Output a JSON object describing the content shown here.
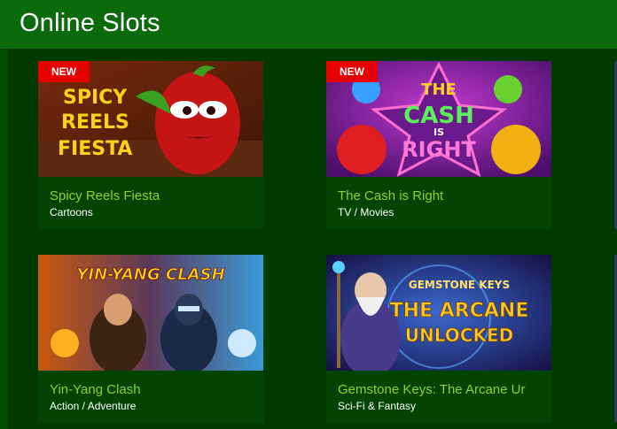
{
  "page": {
    "title": "Online Slots"
  },
  "games": [
    {
      "name": "Spicy Reels Fiesta",
      "category": "Cartoons",
      "badge": "NEW",
      "art_text": "SPICY REELS FIESTA"
    },
    {
      "name": "The Cash is Right",
      "category": "TV / Movies",
      "badge": "NEW",
      "art_text": "THE CASH IS RIGHT"
    },
    {
      "name": "Yin-Yang Clash",
      "category": "Action / Adventure",
      "badge": "",
      "art_text": "YIN-YANG CLASH"
    },
    {
      "name": "Gemstone Keys: The Arcane Ur",
      "category": "Sci-Fi & Fantasy",
      "badge": "",
      "art_text": "GEMSTONE KEYS THE ARCANE UNLOCKED"
    }
  ],
  "colors": {
    "header_bg": "#0b6a0b",
    "content_bg": "#013a01",
    "tile_bg": "#024402",
    "game_name": "#8fd22d",
    "badge_bg": "#e60000"
  }
}
